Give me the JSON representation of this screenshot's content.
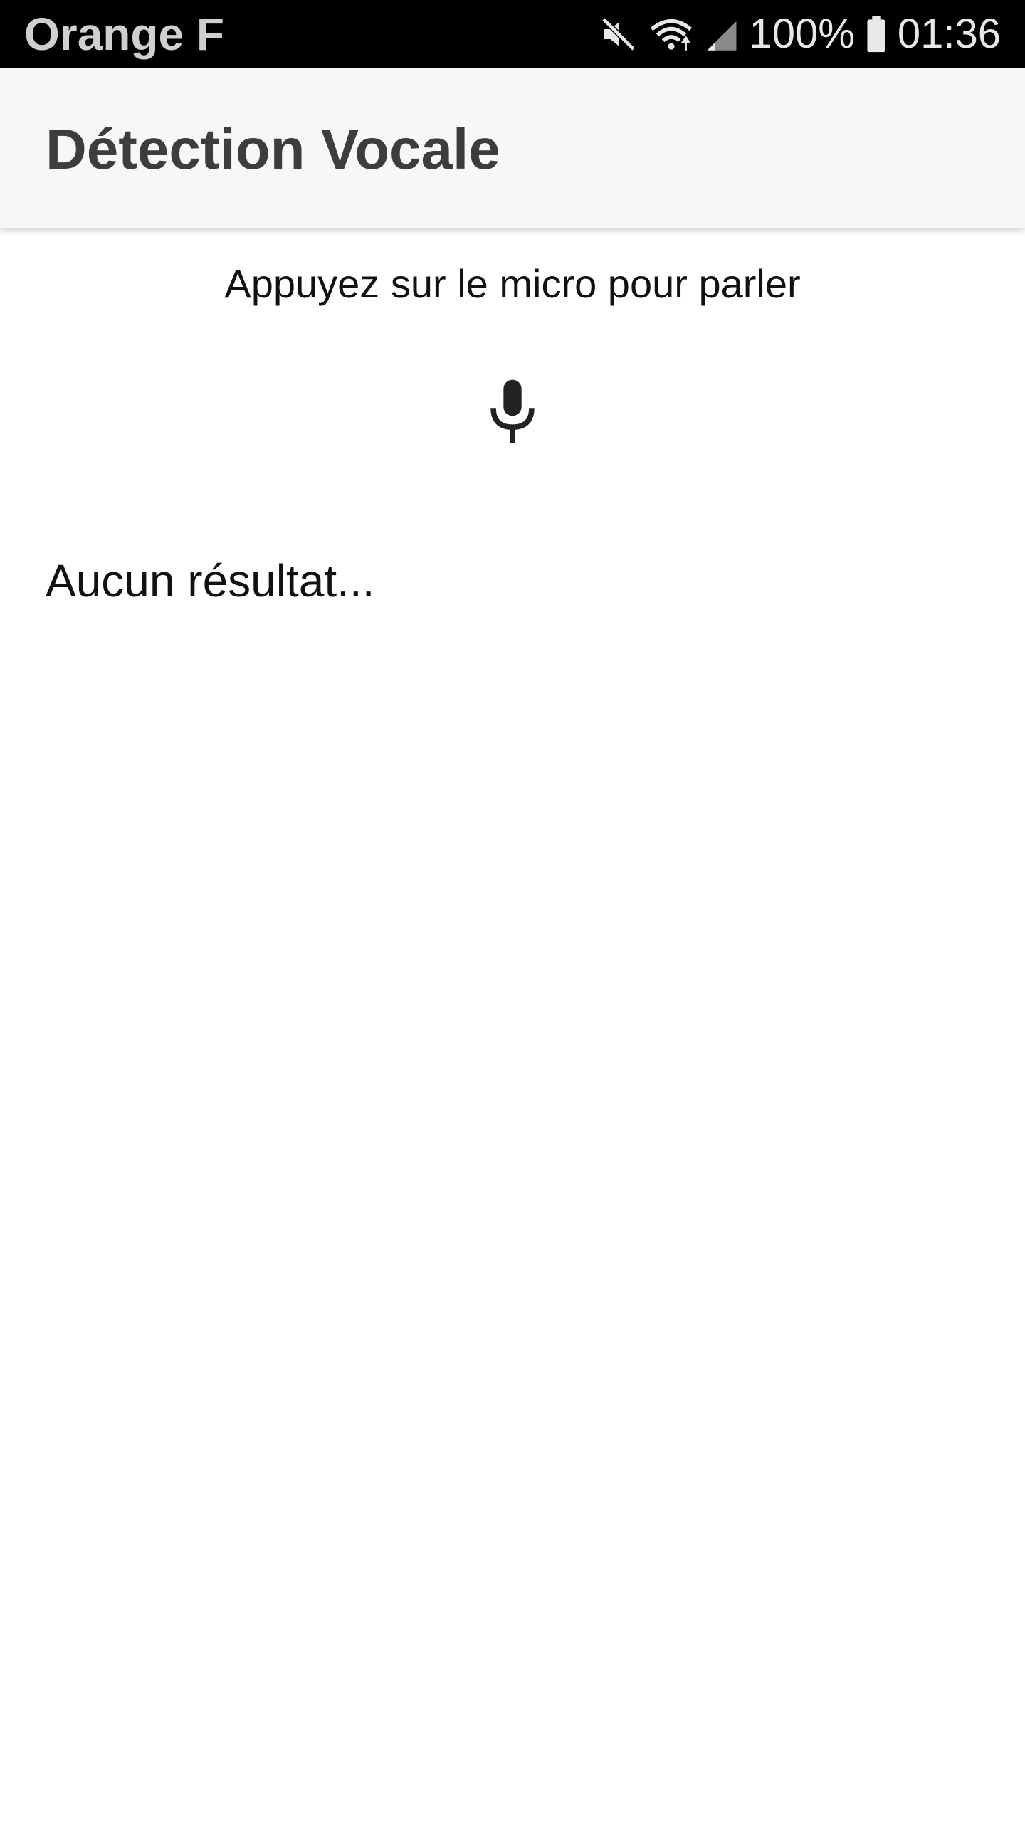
{
  "status_bar": {
    "carrier": "Orange F",
    "battery_percent": "100%",
    "time": "01:36",
    "icons": [
      "mute-icon",
      "wifi-icon",
      "signal-icon",
      "battery-icon"
    ]
  },
  "app_bar": {
    "title": "Détection Vocale"
  },
  "main": {
    "prompt": "Appuyez sur le micro pour parler",
    "mic_icon": "microphone-icon",
    "result_text": "Aucun résultat..."
  },
  "colors": {
    "status_bar_bg": "#000000",
    "app_bar_bg": "#f7f7f7",
    "title_text": "#3d3d3d",
    "body_text": "#111111",
    "icon": "#222222"
  }
}
